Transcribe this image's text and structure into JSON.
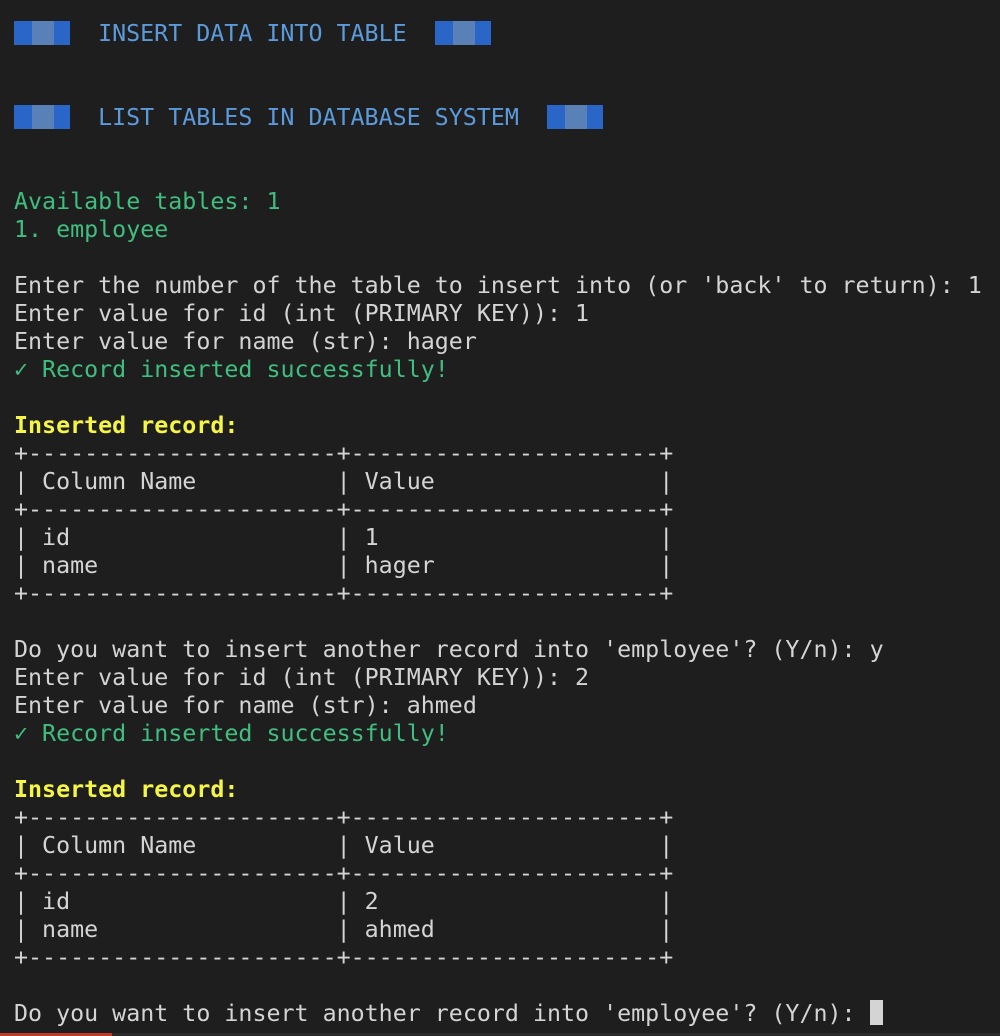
{
  "headers": {
    "insert_title": "INSERT DATA INTO TABLE",
    "list_title": "LIST TABLES IN DATABASE SYSTEM"
  },
  "listing": {
    "available": "Available tables: 1",
    "item1": "1. employee"
  },
  "prompts": {
    "table_number": "Enter the number of the table to insert into (or 'back' to return): 1",
    "id_1": "Enter value for id (int (PRIMARY KEY)): 1",
    "name_1": "Enter value for name (str): hager",
    "success_1": "✓ Record inserted successfully!",
    "again_1": "Do you want to insert another record into 'employee'? (Y/n): y",
    "id_2": "Enter value for id (int (PRIMARY KEY)): 2",
    "name_2": "Enter value for name (str): ahmed",
    "success_2": "✓ Record inserted successfully!",
    "again_2": "Do you want to insert another record into 'employee'? (Y/n): "
  },
  "records": [
    {
      "label": "Inserted record:",
      "border": "+----------------------+----------------------+",
      "header": "| Column Name          | Value                |",
      "row1": "| id                   | 1                    |",
      "row2": "| name                 | hager                |"
    },
    {
      "label": "Inserted record:",
      "border": "+----------------------+----------------------+",
      "header": "| Column Name          | Value                |",
      "row1": "| id                   | 2                    |",
      "row2": "| name                 | ahmed                |"
    }
  ],
  "colors": {
    "background": "#1e1e1e",
    "header_blue": "#5b9bdc",
    "success_green": "#3fbf7f",
    "label_yellow": "#f5f543"
  }
}
